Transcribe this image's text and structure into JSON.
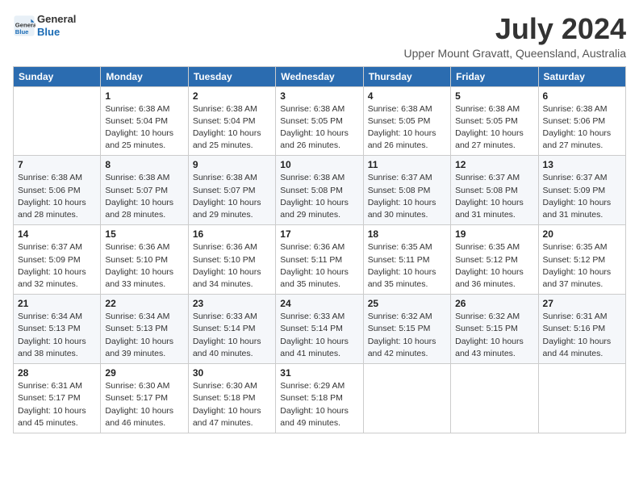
{
  "logo": {
    "general": "General",
    "blue": "Blue"
  },
  "header": {
    "month_year": "July 2024",
    "location": "Upper Mount Gravatt, Queensland, Australia"
  },
  "weekdays": [
    "Sunday",
    "Monday",
    "Tuesday",
    "Wednesday",
    "Thursday",
    "Friday",
    "Saturday"
  ],
  "weeks": [
    [
      {
        "day": "",
        "info": ""
      },
      {
        "day": "1",
        "info": "Sunrise: 6:38 AM\nSunset: 5:04 PM\nDaylight: 10 hours\nand 25 minutes."
      },
      {
        "day": "2",
        "info": "Sunrise: 6:38 AM\nSunset: 5:04 PM\nDaylight: 10 hours\nand 25 minutes."
      },
      {
        "day": "3",
        "info": "Sunrise: 6:38 AM\nSunset: 5:05 PM\nDaylight: 10 hours\nand 26 minutes."
      },
      {
        "day": "4",
        "info": "Sunrise: 6:38 AM\nSunset: 5:05 PM\nDaylight: 10 hours\nand 26 minutes."
      },
      {
        "day": "5",
        "info": "Sunrise: 6:38 AM\nSunset: 5:05 PM\nDaylight: 10 hours\nand 27 minutes."
      },
      {
        "day": "6",
        "info": "Sunrise: 6:38 AM\nSunset: 5:06 PM\nDaylight: 10 hours\nand 27 minutes."
      }
    ],
    [
      {
        "day": "7",
        "info": "Sunrise: 6:38 AM\nSunset: 5:06 PM\nDaylight: 10 hours\nand 28 minutes."
      },
      {
        "day": "8",
        "info": "Sunrise: 6:38 AM\nSunset: 5:07 PM\nDaylight: 10 hours\nand 28 minutes."
      },
      {
        "day": "9",
        "info": "Sunrise: 6:38 AM\nSunset: 5:07 PM\nDaylight: 10 hours\nand 29 minutes."
      },
      {
        "day": "10",
        "info": "Sunrise: 6:38 AM\nSunset: 5:08 PM\nDaylight: 10 hours\nand 29 minutes."
      },
      {
        "day": "11",
        "info": "Sunrise: 6:37 AM\nSunset: 5:08 PM\nDaylight: 10 hours\nand 30 minutes."
      },
      {
        "day": "12",
        "info": "Sunrise: 6:37 AM\nSunset: 5:08 PM\nDaylight: 10 hours\nand 31 minutes."
      },
      {
        "day": "13",
        "info": "Sunrise: 6:37 AM\nSunset: 5:09 PM\nDaylight: 10 hours\nand 31 minutes."
      }
    ],
    [
      {
        "day": "14",
        "info": "Sunrise: 6:37 AM\nSunset: 5:09 PM\nDaylight: 10 hours\nand 32 minutes."
      },
      {
        "day": "15",
        "info": "Sunrise: 6:36 AM\nSunset: 5:10 PM\nDaylight: 10 hours\nand 33 minutes."
      },
      {
        "day": "16",
        "info": "Sunrise: 6:36 AM\nSunset: 5:10 PM\nDaylight: 10 hours\nand 34 minutes."
      },
      {
        "day": "17",
        "info": "Sunrise: 6:36 AM\nSunset: 5:11 PM\nDaylight: 10 hours\nand 35 minutes."
      },
      {
        "day": "18",
        "info": "Sunrise: 6:35 AM\nSunset: 5:11 PM\nDaylight: 10 hours\nand 35 minutes."
      },
      {
        "day": "19",
        "info": "Sunrise: 6:35 AM\nSunset: 5:12 PM\nDaylight: 10 hours\nand 36 minutes."
      },
      {
        "day": "20",
        "info": "Sunrise: 6:35 AM\nSunset: 5:12 PM\nDaylight: 10 hours\nand 37 minutes."
      }
    ],
    [
      {
        "day": "21",
        "info": "Sunrise: 6:34 AM\nSunset: 5:13 PM\nDaylight: 10 hours\nand 38 minutes."
      },
      {
        "day": "22",
        "info": "Sunrise: 6:34 AM\nSunset: 5:13 PM\nDaylight: 10 hours\nand 39 minutes."
      },
      {
        "day": "23",
        "info": "Sunrise: 6:33 AM\nSunset: 5:14 PM\nDaylight: 10 hours\nand 40 minutes."
      },
      {
        "day": "24",
        "info": "Sunrise: 6:33 AM\nSunset: 5:14 PM\nDaylight: 10 hours\nand 41 minutes."
      },
      {
        "day": "25",
        "info": "Sunrise: 6:32 AM\nSunset: 5:15 PM\nDaylight: 10 hours\nand 42 minutes."
      },
      {
        "day": "26",
        "info": "Sunrise: 6:32 AM\nSunset: 5:15 PM\nDaylight: 10 hours\nand 43 minutes."
      },
      {
        "day": "27",
        "info": "Sunrise: 6:31 AM\nSunset: 5:16 PM\nDaylight: 10 hours\nand 44 minutes."
      }
    ],
    [
      {
        "day": "28",
        "info": "Sunrise: 6:31 AM\nSunset: 5:17 PM\nDaylight: 10 hours\nand 45 minutes."
      },
      {
        "day": "29",
        "info": "Sunrise: 6:30 AM\nSunset: 5:17 PM\nDaylight: 10 hours\nand 46 minutes."
      },
      {
        "day": "30",
        "info": "Sunrise: 6:30 AM\nSunset: 5:18 PM\nDaylight: 10 hours\nand 47 minutes."
      },
      {
        "day": "31",
        "info": "Sunrise: 6:29 AM\nSunset: 5:18 PM\nDaylight: 10 hours\nand 49 minutes."
      },
      {
        "day": "",
        "info": ""
      },
      {
        "day": "",
        "info": ""
      },
      {
        "day": "",
        "info": ""
      }
    ]
  ]
}
